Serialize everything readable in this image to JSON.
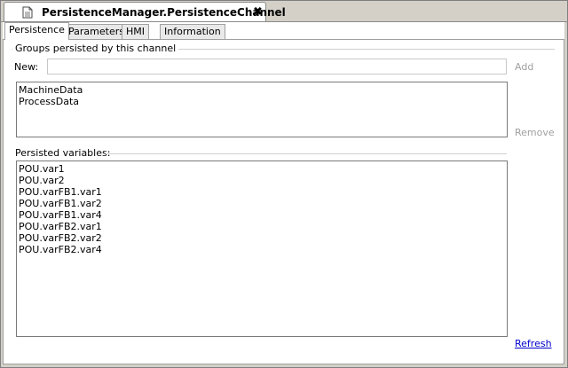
{
  "document": {
    "title": "PersistenceManager.PersistenceChannel",
    "close_glyph": "✖"
  },
  "tabs": [
    {
      "label": "Persistence",
      "active": true
    },
    {
      "label": "Parameters",
      "active": false
    },
    {
      "label": "HMI",
      "active": false
    },
    {
      "label": "Information",
      "active": false
    }
  ],
  "groups": {
    "legend": "Groups persisted by this channel",
    "new_label": "New:",
    "new_value": "",
    "add_label": "Add",
    "remove_label": "Remove",
    "items": [
      "MachineData",
      "ProcessData"
    ]
  },
  "variables": {
    "label": "Persisted variables:",
    "items": [
      "POU.var1",
      "POU.var2",
      "POU.varFB1.var1",
      "POU.varFB1.var2",
      "POU.varFB1.var4",
      "POU.varFB2.var1",
      "POU.varFB2.var2",
      "POU.varFB2.var4"
    ],
    "refresh_label": "Refresh"
  }
}
